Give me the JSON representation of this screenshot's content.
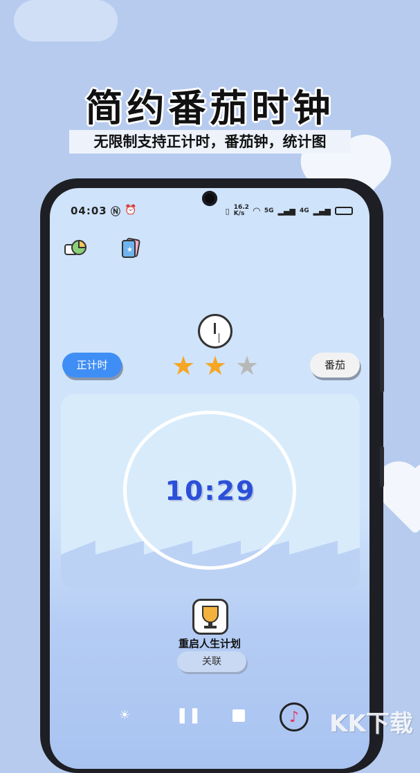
{
  "promo": {
    "headline": "简约番茄时钟",
    "subheadline": "无限制支持正计时，番茄钟，统计图"
  },
  "status_bar": {
    "time": "04:03",
    "speed_top": "16.2",
    "speed_bottom": "K/s",
    "network1": "5G",
    "network2": "4G"
  },
  "app": {
    "mode_left_label": "正计时",
    "mode_right_label": "番茄",
    "stars": {
      "filled": 2,
      "total": 3
    },
    "timer_value": "10:29",
    "plan_name": "重启人生计划",
    "link_label": "关联"
  },
  "watermark": "KK下载",
  "colors": {
    "accent_blue": "#3f8ef5",
    "timer_text": "#2b4fd8",
    "star_filled": "#f5a623",
    "star_empty": "#b8b8b8"
  }
}
